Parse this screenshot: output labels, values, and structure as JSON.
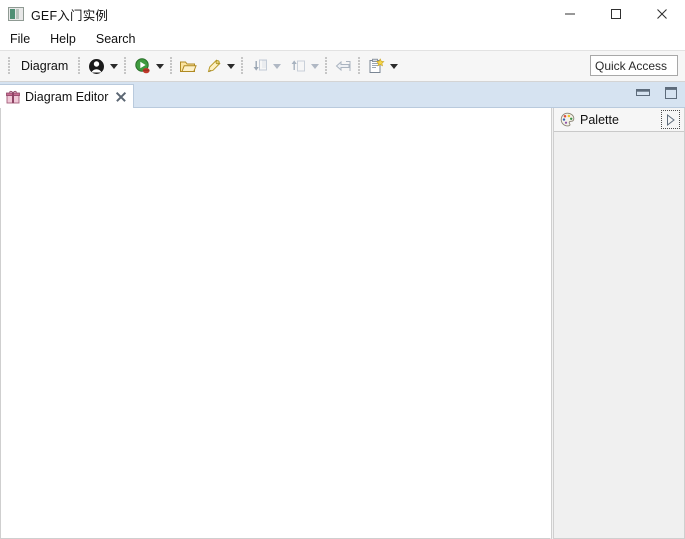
{
  "window": {
    "title": "GEF入门实例",
    "app_icon": "app-icon",
    "controls": [
      {
        "name": "minimize-window-button",
        "glyph": "minimize-icon"
      },
      {
        "name": "maximize-window-button",
        "glyph": "maximize-icon"
      },
      {
        "name": "close-window-button",
        "glyph": "close-icon"
      }
    ]
  },
  "menubar": {
    "items": [
      {
        "label": "File"
      },
      {
        "label": "Help"
      },
      {
        "label": "Search"
      }
    ]
  },
  "toolbar": {
    "section_label": "Diagram",
    "items": [
      {
        "name": "person-icon",
        "has_dropdown": true,
        "enabled": true
      },
      {
        "name": "run-icon",
        "has_dropdown": true,
        "enabled": true
      },
      {
        "name": "open-folder-icon",
        "has_dropdown": false,
        "enabled": true
      },
      {
        "name": "pin-icon",
        "has_dropdown": true,
        "enabled": true
      },
      {
        "name": "step-into-icon",
        "has_dropdown": true,
        "enabled": false
      },
      {
        "name": "step-return-icon",
        "has_dropdown": true,
        "enabled": false
      },
      {
        "name": "back-arrow-icon",
        "has_dropdown": false,
        "enabled": false
      },
      {
        "name": "new-document-icon",
        "has_dropdown": true,
        "enabled": true
      }
    ],
    "quick_access": {
      "value": "Quick Access",
      "placeholder": "Quick Access"
    }
  },
  "editor": {
    "tab": {
      "label": "Diagram Editor",
      "icon": "diagram-editor-icon",
      "close": "close-tab-icon",
      "active": true
    },
    "controls": [
      {
        "name": "minimize-editor-button",
        "glyph": "minimize-panel-icon"
      },
      {
        "name": "maximize-editor-button",
        "glyph": "maximize-panel-icon"
      }
    ],
    "canvas": {
      "content": ""
    }
  },
  "palette": {
    "title": "Palette",
    "icon": "palette-icon",
    "expand_button": "expand-palette-icon",
    "items": []
  },
  "colors": {
    "tabbar_background": "#d6e3f1",
    "toolbar_background": "#f6f6f6",
    "palette_background": "#f0f0f0",
    "canvas_background": "#ffffff",
    "border": "#cfcfcf",
    "accent_green": "#4f8f74"
  }
}
